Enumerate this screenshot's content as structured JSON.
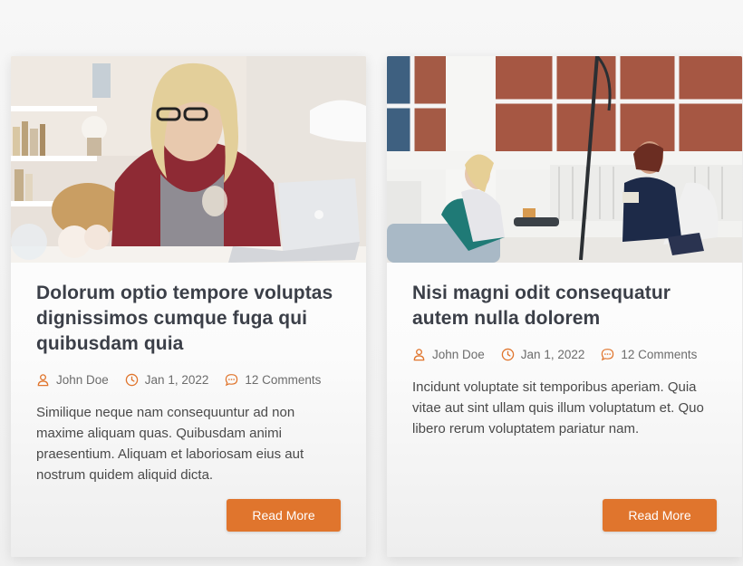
{
  "accent_color": "#e0752d",
  "posts": [
    {
      "image_alt": "Woman with glasses smiling at laptop",
      "title": "Dolorum optio tempore voluptas dignissimos cumque fuga qui quibusdam quia",
      "author": "John Doe",
      "date": "Jan 1, 2022",
      "comments": "12 Comments",
      "excerpt": "Similique neque nam consequuntur ad non maxime aliquam quas. Quibusdam animi praesentium. Aliquam et laboriosam eius aut nostrum quidem aliquid dicta.",
      "button_label": "Read More"
    },
    {
      "image_alt": "Two women in a counseling session in a bright room",
      "title": "Nisi magni odit consequatur autem nulla dolorem",
      "author": "John Doe",
      "date": "Jan 1, 2022",
      "comments": "12 Comments",
      "excerpt": "Incidunt voluptate sit temporibus aperiam. Quia vitae aut sint ullam quis illum voluptatum et. Quo libero rerum voluptatem pariatur nam.",
      "button_label": "Read More"
    }
  ],
  "icons": {
    "author": "user-icon",
    "date": "clock-icon",
    "comments": "comment-icon"
  }
}
